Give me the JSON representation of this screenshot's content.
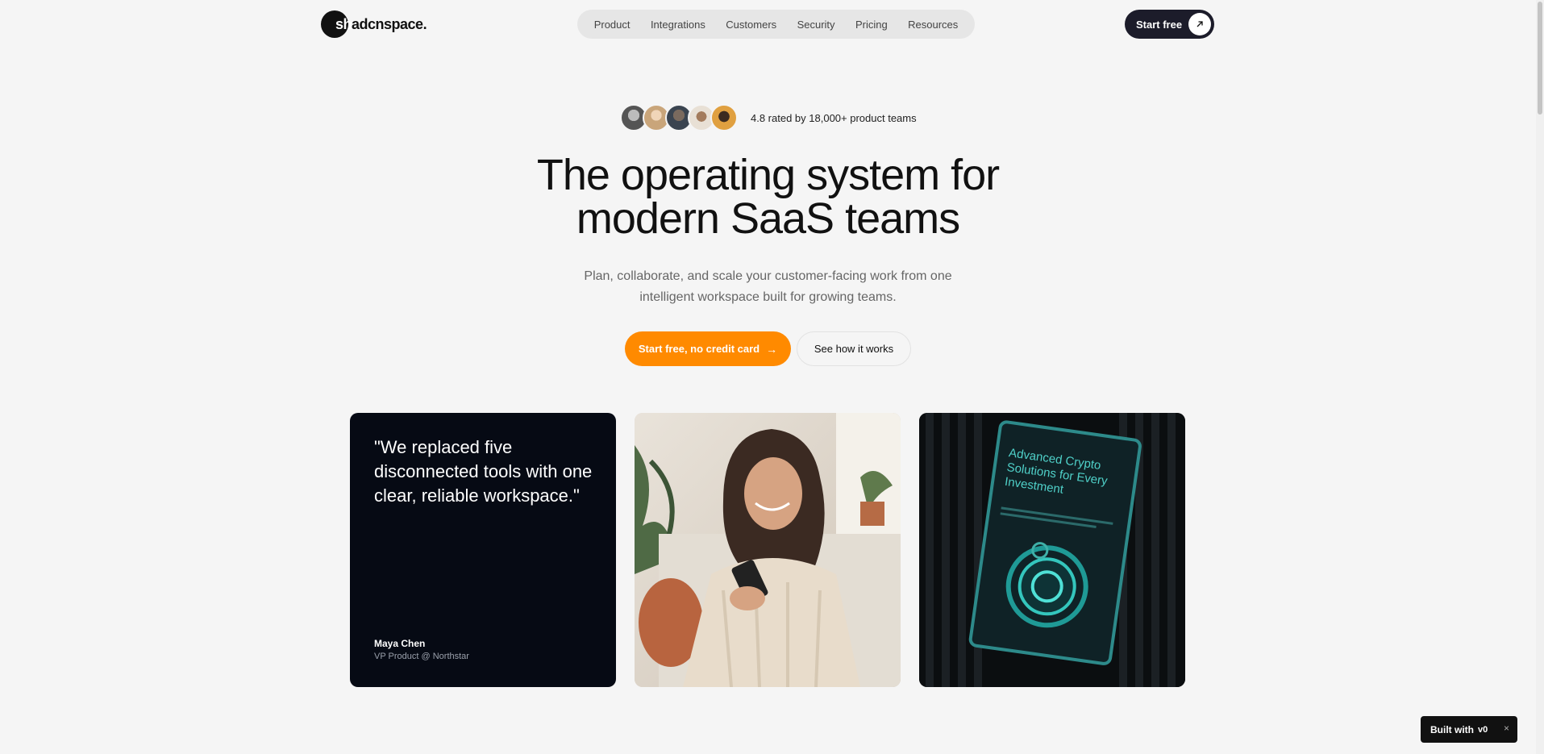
{
  "header": {
    "logo_first": "sh",
    "logo_rest": "adcnspace.",
    "nav": [
      "Product",
      "Integrations",
      "Customers",
      "Security",
      "Pricing",
      "Resources"
    ],
    "cta_label": "Start free"
  },
  "hero": {
    "rating_text": "4.8 rated by 18,000+ product teams",
    "title_line1": "The operating system for",
    "title_line2": "modern SaaS teams",
    "subtitle_line1": "Plan, collaborate, and scale your customer-facing work from one",
    "subtitle_line2": "intelligent workspace built for growing teams.",
    "primary_cta": "Start free, no credit card",
    "secondary_cta": "See how it works"
  },
  "testimonial": {
    "quote": "\"We replaced five disconnected tools with one clear, reliable workspace.\"",
    "name": "Maya Chen",
    "role": "VP Product @ Northstar"
  },
  "poster": {
    "title": "Advanced Crypto Solutions for Every Investment"
  },
  "badge": {
    "label": "Built with",
    "logo": "v0",
    "close": "×"
  },
  "colors": {
    "accent": "#ff8a00",
    "dark": "#1c1c2a",
    "card_dark": "#060a14",
    "background": "#f5f5f5"
  }
}
